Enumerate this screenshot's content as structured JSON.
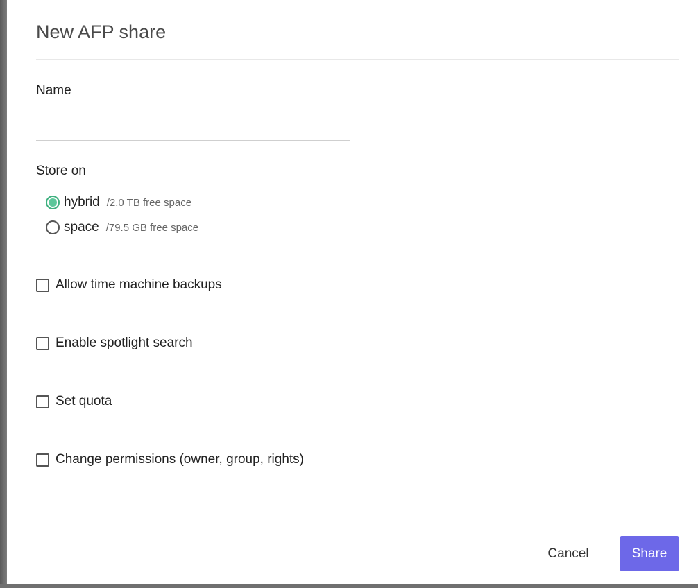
{
  "dialog": {
    "title": "New AFP share"
  },
  "name_field": {
    "label": "Name",
    "value": "",
    "placeholder": ""
  },
  "store_on": {
    "label": "Store on",
    "options": [
      {
        "label": "hybrid",
        "detail": "/2.0 TB free space",
        "selected": true
      },
      {
        "label": "space",
        "detail": "/79.5 GB free space",
        "selected": false
      }
    ]
  },
  "options": {
    "time_machine": {
      "label": "Allow time machine backups",
      "checked": false
    },
    "spotlight": {
      "label": "Enable spotlight search",
      "checked": false
    },
    "quota": {
      "label": "Set quota",
      "checked": false
    },
    "permissions": {
      "label": "Change permissions (owner, group, rights)",
      "checked": false
    }
  },
  "actions": {
    "cancel_label": "Cancel",
    "share_label": "Share"
  },
  "colors": {
    "accent": "#6d68e8",
    "radio_selected": "#5cc79a"
  },
  "icons": {
    "radio_selected": "radio-selected-icon",
    "radio_unselected": "radio-unselected-icon",
    "checkbox_unchecked": "checkbox-unchecked-icon"
  }
}
